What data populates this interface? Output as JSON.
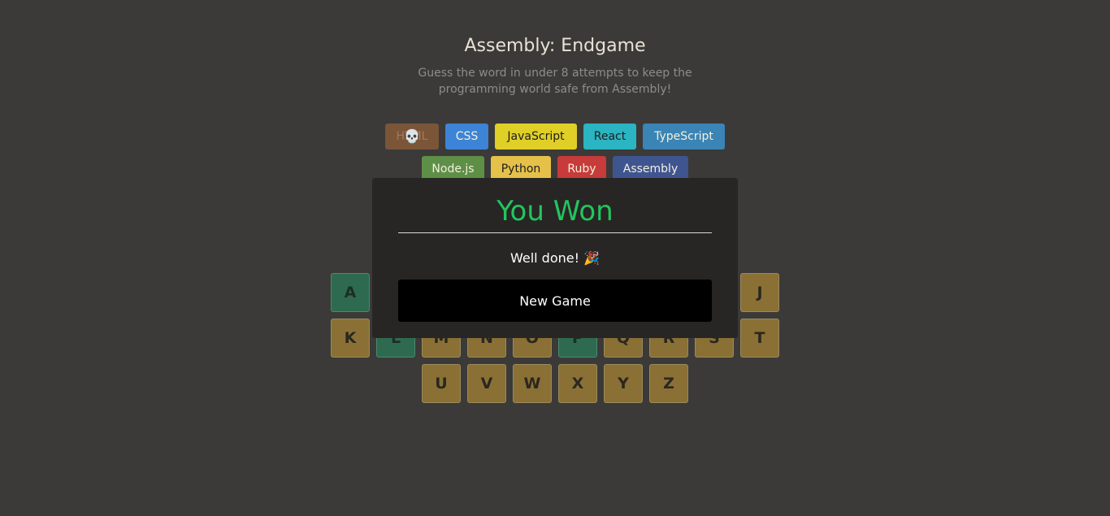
{
  "header": {
    "title": "Assembly: Endgame",
    "subtitle": "Guess the word in under 8 attempts to keep the programming world safe from Assembly!"
  },
  "languages": [
    {
      "name": "HTML",
      "bg": "#7a5538",
      "color": "#a07a5a",
      "lost": true,
      "lost_icon": "💀"
    },
    {
      "name": "CSS",
      "bg": "#328AF1",
      "color": "#F9F4DA",
      "lost": false
    },
    {
      "name": "JavaScript",
      "bg": "#E2D026",
      "color": "#1E1E1E",
      "lost": false
    },
    {
      "name": "React",
      "bg": "#2BB4C2",
      "color": "#1E1E1E",
      "lost": false
    },
    {
      "name": "TypeScript",
      "bg": "#3A84B6",
      "color": "#F9F4DA",
      "lost": false
    },
    {
      "name": "Node.js",
      "bg": "#5E8F47",
      "color": "#F9F4DA",
      "lost": false
    },
    {
      "name": "Python",
      "bg": "#E5C14A",
      "color": "#1E1E1E",
      "lost": false
    },
    {
      "name": "Ruby",
      "bg": "#C73B3B",
      "color": "#F9F4DA",
      "lost": false
    },
    {
      "name": "Assembly",
      "bg": "#3E5590",
      "color": "#F9F4DA",
      "lost": false
    }
  ],
  "keyboard": [
    {
      "letter": "A",
      "status": "correct"
    },
    {
      "letter": "J",
      "status": "wrong"
    },
    {
      "letter": "K",
      "status": "wrong"
    },
    {
      "letter": "L",
      "status": "correct"
    },
    {
      "letter": "M",
      "status": "wrong"
    },
    {
      "letter": "N",
      "status": "wrong"
    },
    {
      "letter": "O",
      "status": "wrong"
    },
    {
      "letter": "P",
      "status": "correct"
    },
    {
      "letter": "Q",
      "status": "wrong"
    },
    {
      "letter": "R",
      "status": "wrong"
    },
    {
      "letter": "S",
      "status": "wrong"
    },
    {
      "letter": "T",
      "status": "wrong"
    },
    {
      "letter": "U",
      "status": "wrong"
    },
    {
      "letter": "V",
      "status": "wrong"
    },
    {
      "letter": "W",
      "status": "wrong"
    },
    {
      "letter": "X",
      "status": "wrong"
    },
    {
      "letter": "Y",
      "status": "wrong"
    },
    {
      "letter": "Z",
      "status": "wrong"
    }
  ],
  "modal": {
    "title": "You Won",
    "message": "Well done! 🎉",
    "button": "New Game",
    "title_color": "#22c55e"
  }
}
